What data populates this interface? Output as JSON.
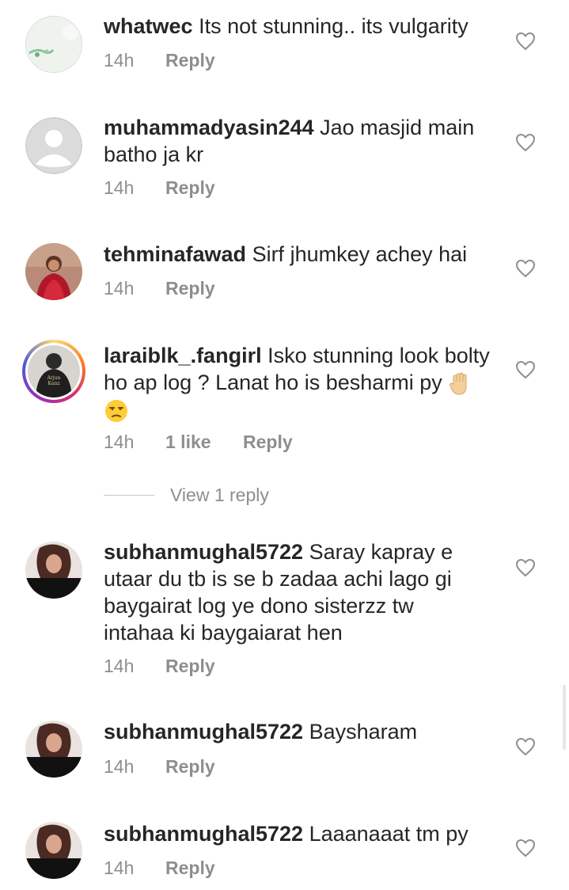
{
  "comments": [
    {
      "username": "whatwec",
      "text": "Its not stunning.. its vulgarity",
      "time": "14h",
      "reply": "Reply"
    },
    {
      "username": "muhammadyasin244",
      "text": "Jao masjid main batho ja kr",
      "time": "14h",
      "reply": "Reply"
    },
    {
      "username": "tehminafawad",
      "text": "Sirf jhumkey achey hai",
      "time": "14h",
      "reply": "Reply"
    },
    {
      "username": "laraiblk_.fangirl",
      "text": "Isko stunning look bolty ho ap log ? Lanat ho is besharmi py",
      "time": "14h",
      "likes": "1 like",
      "reply": "Reply",
      "view_replies": "View 1 reply",
      "emojis": [
        "raised-hand-emoji",
        "unamused-face-emoji"
      ],
      "avatar_lettering": "Arjun Kanz"
    },
    {
      "username": "subhanmughal5722",
      "text": "Saray kapray e utaar du tb is se b zadaa achi lago gi baygairat log ye dono sisterzz tw intahaa ki baygaiarat hen",
      "time": "14h",
      "reply": "Reply"
    },
    {
      "username": "subhanmughal5722",
      "text": "Baysharam",
      "time": "14h",
      "reply": "Reply"
    },
    {
      "username": "subhanmughal5722",
      "text": "Laaanaaat tm py",
      "time": "14h",
      "reply": "Reply"
    }
  ],
  "icons": {
    "like": "heart-outline-icon",
    "default_avatar": "person-silhouette-icon"
  },
  "colors": {
    "text": "#262626",
    "secondary": "#8e8e8e",
    "story_ring_start": "#feda75",
    "story_ring_end": "#962fbf"
  }
}
